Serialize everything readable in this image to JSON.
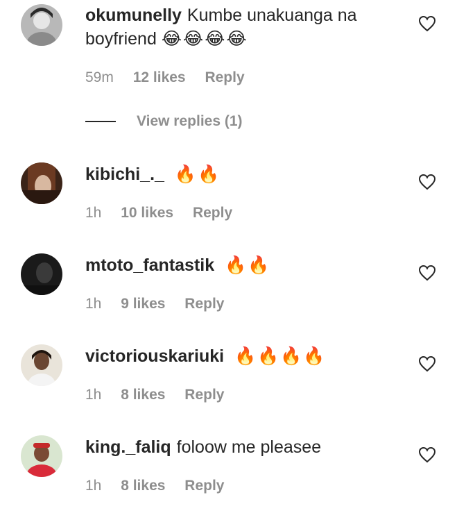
{
  "comments": [
    {
      "username": "okumunelly",
      "text": "Kumbe unakuanga na boyfriend",
      "emoji": "😂😂😂😂",
      "time": "59m",
      "likes": "12 likes",
      "reply": "Reply",
      "view_replies": "View replies (1)"
    },
    {
      "username": "kibichi_._",
      "text": "",
      "emoji": "🔥🔥",
      "time": "1h",
      "likes": "10 likes",
      "reply": "Reply"
    },
    {
      "username": "mtoto_fantastik",
      "text": "",
      "emoji": "🔥🔥",
      "time": "1h",
      "likes": "9 likes",
      "reply": "Reply"
    },
    {
      "username": "victoriouskariuki",
      "text": "",
      "emoji": "🔥🔥🔥🔥",
      "time": "1h",
      "likes": "8 likes",
      "reply": "Reply"
    },
    {
      "username": "king._faliq",
      "text": "foloow me pleasee",
      "emoji": "",
      "time": "1h",
      "likes": "8 likes",
      "reply": "Reply"
    }
  ],
  "icons": {
    "like": "heart-outline-icon"
  },
  "colors": {
    "text": "#262626",
    "meta": "#8e8e8e",
    "background": "#ffffff"
  }
}
